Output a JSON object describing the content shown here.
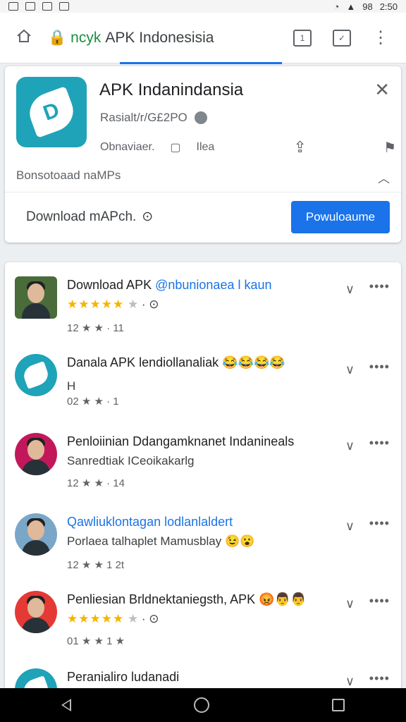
{
  "status": {
    "time": "2:50",
    "battery": "98"
  },
  "browser": {
    "url_prefix": "ncyk",
    "url_text": "APK Indonesisia"
  },
  "app_card": {
    "title": "APK Indanindansia",
    "subtitle": "Rasialt/r/G£2PO",
    "row_label": "Obnaviaer.",
    "row_label2": "Ilea",
    "download_info": "Bonsotoaad naMPs",
    "download_text": "Download mAPch.",
    "download_button": "Powuloaume"
  },
  "list": {
    "items": [
      {
        "title": "Download APK",
        "title_hl": "@nbunionaea l kaun",
        "stars": "★★★★★",
        "meta": "12 ★ ★ · 11"
      },
      {
        "title": "Danala APK lendiollanaliak",
        "emoji": "😂😂😂😂",
        "sub": "H",
        "meta": "02 ★ ★ · 1"
      },
      {
        "title": "Penloiinian Ddangamknanet Indanineals",
        "sub": "Sanredtiak ICeoikakarlg",
        "meta": "12 ★ ★ · 14"
      },
      {
        "title": "Qawliuklontagan lodlanlaldert",
        "sub": "Porlaea talhaplet Mamusblay",
        "emoji": "😉😮",
        "meta": "12 ★ ★ 1 2t"
      },
      {
        "title": "Penliesian Brldnektaniegsth, APK",
        "emoji": "😡👨👨",
        "stars": "★★★★★",
        "meta": "01 ★ ★ 1 ★"
      },
      {
        "title": "Peranialiro ludanadi",
        "meta": ""
      }
    ]
  }
}
